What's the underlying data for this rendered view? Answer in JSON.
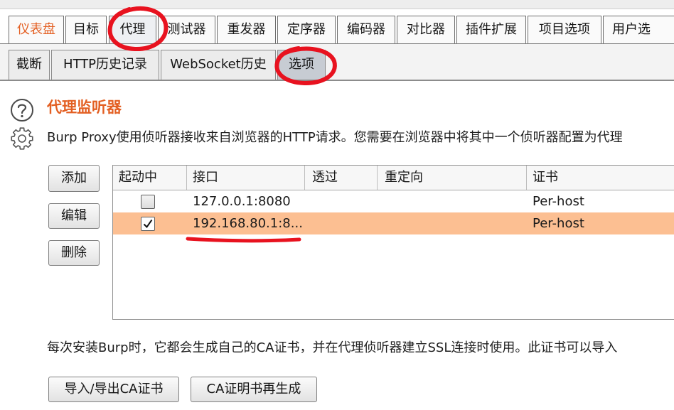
{
  "colors": {
    "accent": "#E35F22",
    "selected_row": "#FCBF92",
    "annotation": "#E8121F",
    "active_subtab": "#C7CCD3"
  },
  "main_tabs": [
    {
      "label": "仪表盘",
      "activity": true
    },
    {
      "label": "目标"
    },
    {
      "label": "代理",
      "active": true
    },
    {
      "label": "测试器"
    },
    {
      "label": "重发器"
    },
    {
      "label": "定序器"
    },
    {
      "label": "编码器"
    },
    {
      "label": "对比器"
    },
    {
      "label": "插件扩展"
    },
    {
      "label": "项目选项"
    },
    {
      "label": "用户选"
    }
  ],
  "sub_tabs": [
    {
      "label": "截断"
    },
    {
      "label": "HTTP历史记录"
    },
    {
      "label": "WebSocket历史"
    },
    {
      "label": "选项",
      "active": true
    }
  ],
  "proxy_listeners": {
    "help_icon": "help-icon",
    "settings_icon": "gear-icon",
    "title": "代理监听器",
    "description": "Burp Proxy使用侦听器接收来自浏览器的HTTP请求。您需要在浏览器中将其中一个侦听器配置为代理",
    "buttons": {
      "add": "添加",
      "edit": "编辑",
      "remove": "删除"
    },
    "table": {
      "columns": [
        "起动中",
        "接口",
        "透过",
        "重定向",
        "证书"
      ],
      "rows": [
        {
          "running": false,
          "interface": "127.0.0.1:8080",
          "invisible": "",
          "redirect": "",
          "certificate": "Per-host",
          "selected": false
        },
        {
          "running": true,
          "interface": "192.168.80.1:8...",
          "invisible": "",
          "redirect": "",
          "certificate": "Per-host",
          "selected": true
        }
      ]
    }
  },
  "ca_certificate": {
    "description": "每次安装Burp时，它都会生成自己的CA证书，并在代理侦听器建立SSL连接时使用。此证书可以导入",
    "buttons": {
      "import_export": "导入/导出CA证书",
      "regenerate": "CA证明书再生成"
    }
  }
}
